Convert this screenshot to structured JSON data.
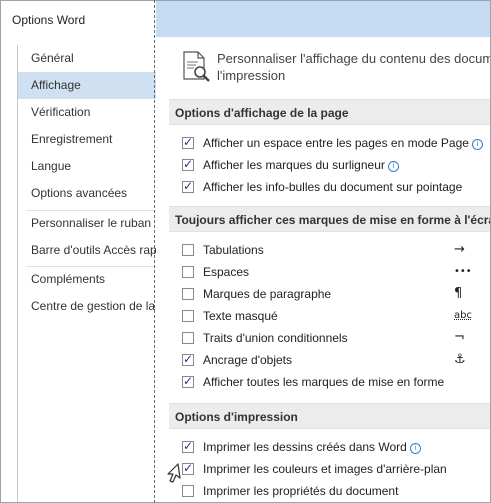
{
  "window": {
    "title": "Options Word"
  },
  "sidebar": {
    "items": [
      {
        "label": "Général"
      },
      {
        "label": "Affichage",
        "selected": true
      },
      {
        "label": "Vérification"
      },
      {
        "label": "Enregistrement"
      },
      {
        "label": "Langue"
      },
      {
        "label": "Options avancées"
      },
      {
        "label": "Personnaliser le ruban"
      },
      {
        "label": "Barre d'outils Accès rapide"
      },
      {
        "label": "Compléments"
      },
      {
        "label": "Centre de gestion de la confidentialité"
      }
    ]
  },
  "content": {
    "intro": {
      "icon": "document-magnifier-icon",
      "line1": "Personnaliser l'affichage du contenu des documents",
      "line2": "l'impression"
    },
    "sections": [
      {
        "header": "Options d'affichage de la page",
        "options": [
          {
            "label": "Afficher un espace entre les pages en mode Page",
            "checked": true,
            "info": true
          },
          {
            "label": "Afficher les marques du surligneur",
            "checked": true,
            "info": true
          },
          {
            "label": "Afficher les info-bulles du document sur pointage",
            "checked": true
          }
        ]
      },
      {
        "header": "Toujours afficher ces marques de mise en forme à l'écran",
        "options": [
          {
            "label": "Tabulations",
            "checked": false,
            "glyph": "→"
          },
          {
            "label": "Espaces",
            "checked": false,
            "glyph": "•••"
          },
          {
            "label": "Marques de paragraphe",
            "checked": false,
            "glyph": "¶"
          },
          {
            "label": "Texte masqué",
            "checked": false,
            "glyph": "abc"
          },
          {
            "label": "Traits d'union conditionnels",
            "checked": false,
            "glyph": "¬"
          },
          {
            "label": "Ancrage d'objets",
            "checked": true,
            "glyph": "⚓"
          },
          {
            "label": "Afficher toutes les marques de mise en forme",
            "checked": true
          }
        ]
      },
      {
        "header": "Options d'impression",
        "options": [
          {
            "label": "Imprimer les dessins créés dans Word",
            "checked": true,
            "info": true
          },
          {
            "label": "Imprimer les couleurs et images d'arrière-plan",
            "checked": true
          },
          {
            "label": "Imprimer les propriétés du document",
            "checked": false
          }
        ]
      }
    ]
  },
  "colors": {
    "accent_titlebar": "#c5dcf3",
    "selected_item": "#cfe0f3",
    "section_header_bg": "#ececec",
    "info_icon": "#3a7bd5"
  }
}
